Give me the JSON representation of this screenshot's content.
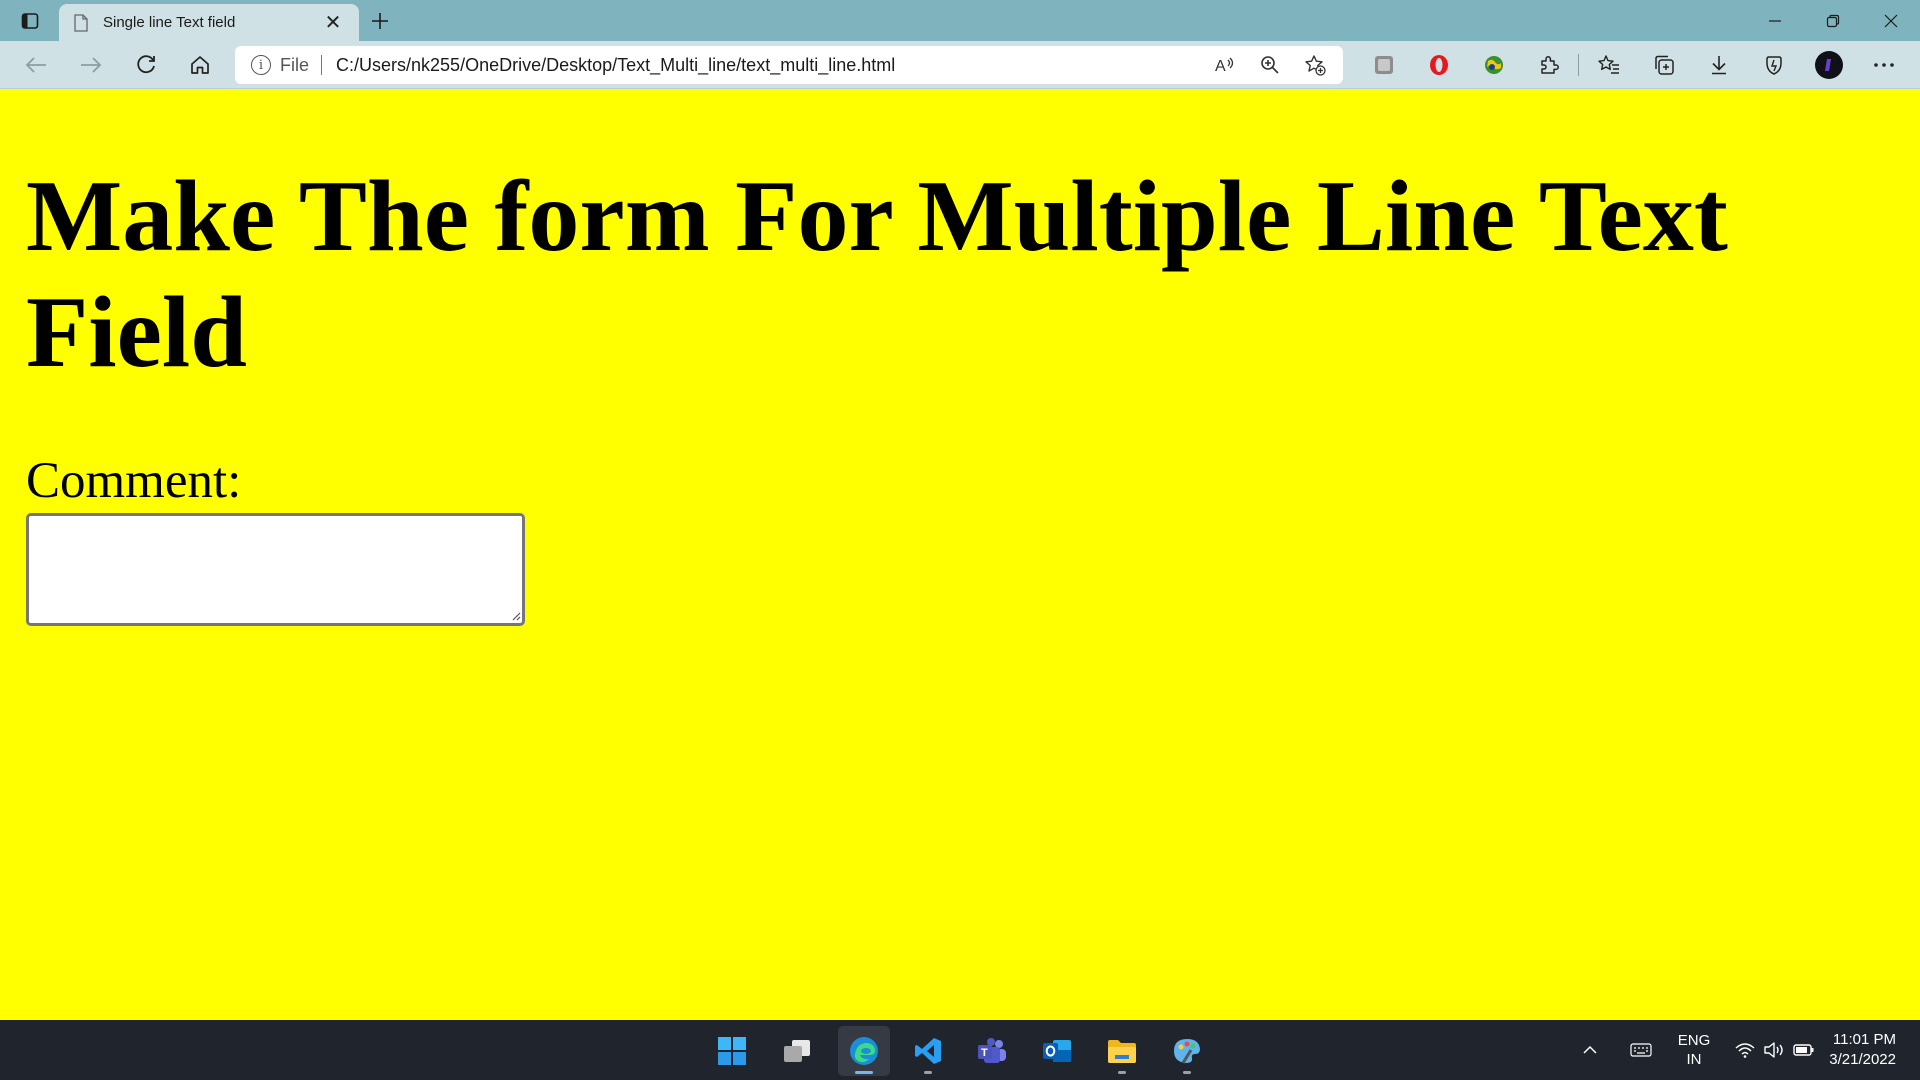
{
  "browser": {
    "tab": {
      "title": "Single line Text field"
    },
    "address": {
      "scheme_label": "File",
      "url": "C:/Users/nk255/OneDrive/Desktop/Text_Multi_line/text_multi_line.html"
    }
  },
  "page": {
    "heading": "Make The form For Multiple Line Text Field",
    "comment_label": "Comment:",
    "comment_value": "",
    "background_color": "#ffff00"
  },
  "taskbar": {
    "language": {
      "line1": "ENG",
      "line2": "IN"
    },
    "time": "11:01 PM",
    "date": "3/21/2022"
  }
}
